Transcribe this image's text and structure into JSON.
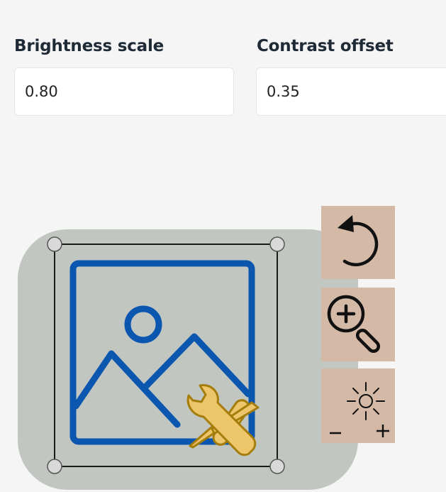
{
  "fields": {
    "brightness": {
      "label": "Brightness scale",
      "value": "0.80"
    },
    "contrast": {
      "label": "Contrast offset",
      "value": "0.35"
    }
  },
  "canvas": {
    "icon": "image-edit-icon",
    "selection_handles": 4
  },
  "tools": [
    {
      "name": "rotate",
      "icon": "rotate-icon"
    },
    {
      "name": "zoom",
      "icon": "zoom-in-icon"
    },
    {
      "name": "brightness",
      "icon": "brightness-adjust-icon"
    }
  ],
  "colors": {
    "canvas_bg": "#c1c6c1",
    "tool_bg": "#d3b9a6",
    "image_icon": "#0b57b0",
    "tools_icon": "#c99a16"
  }
}
